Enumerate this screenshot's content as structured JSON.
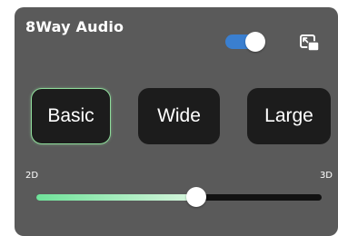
{
  "panel": {
    "title": "8Way Audio",
    "toggle_on": true,
    "toggle_color": "#3a7fd0",
    "pip_icon": "picture-in-picture-icon"
  },
  "modes": {
    "items": [
      {
        "label": "Basic",
        "selected": true
      },
      {
        "label": "Wide",
        "selected": false
      },
      {
        "label": "Large",
        "selected": false
      }
    ],
    "selected_border_color": "#8fdc9b"
  },
  "slider": {
    "min_label": "2D",
    "max_label": "3D",
    "value_fraction": 0.56,
    "fill_color": "#6fe39a"
  }
}
